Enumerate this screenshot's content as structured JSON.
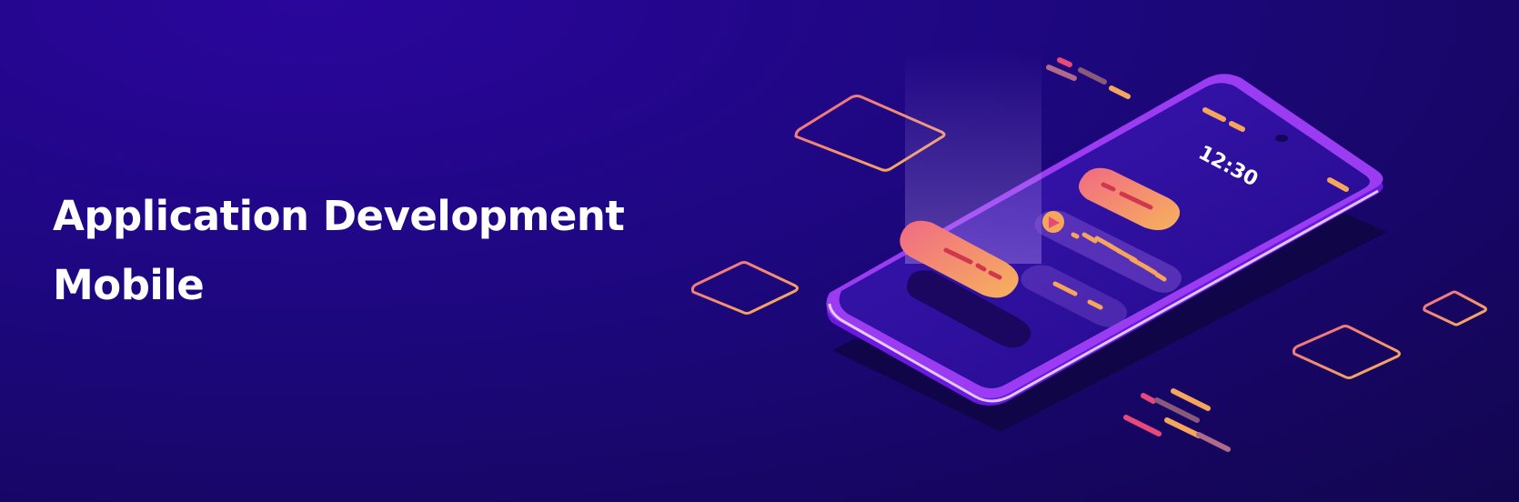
{
  "banner": {
    "title_line1": "Application Development",
    "title_line2": "Mobile",
    "phone_time": "12:30"
  },
  "colors": {
    "background": "#1d077e",
    "accent_orange": "#f5a65b",
    "accent_pink": "#e8487a",
    "phone_frame": "#9b3cf2",
    "text": "#ffffff"
  },
  "icons": [
    "play-icon",
    "audio-waveform-icon"
  ]
}
